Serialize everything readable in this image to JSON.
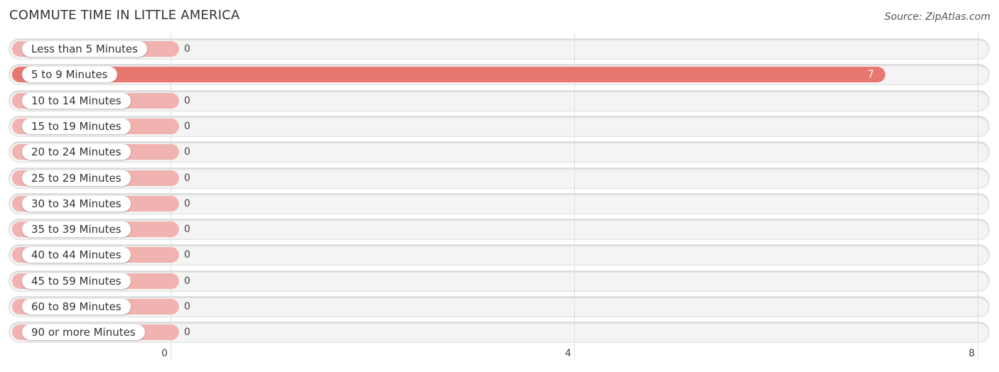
{
  "header": {
    "title": "COMMUTE TIME IN LITTLE AMERICA",
    "source": "Source: ZipAtlas.com"
  },
  "colors": {
    "highlight_bar": "#E8776F",
    "normal_bar": "#F0B3B0",
    "track": "#F4F4F4"
  },
  "chart_data": {
    "type": "bar",
    "orientation": "horizontal",
    "title": "COMMUTE TIME IN LITTLE AMERICA",
    "xlabel": "",
    "ylabel": "",
    "categories": [
      "Less than 5 Minutes",
      "5 to 9 Minutes",
      "10 to 14 Minutes",
      "15 to 19 Minutes",
      "20 to 24 Minutes",
      "25 to 29 Minutes",
      "30 to 34 Minutes",
      "35 to 39 Minutes",
      "40 to 44 Minutes",
      "45 to 59 Minutes",
      "60 to 89 Minutes",
      "90 or more Minutes"
    ],
    "values": [
      0,
      7,
      0,
      0,
      0,
      0,
      0,
      0,
      0,
      0,
      0,
      0
    ],
    "value_labels": [
      "0",
      "7",
      "0",
      "0",
      "0",
      "0",
      "0",
      "0",
      "0",
      "0",
      "0",
      "0"
    ],
    "xlim": [
      0,
      8
    ],
    "x_ticks": [
      0,
      4,
      8
    ],
    "x_tick_labels": [
      "0",
      "4",
      "8"
    ],
    "grid": true,
    "highlight_index": 1
  }
}
